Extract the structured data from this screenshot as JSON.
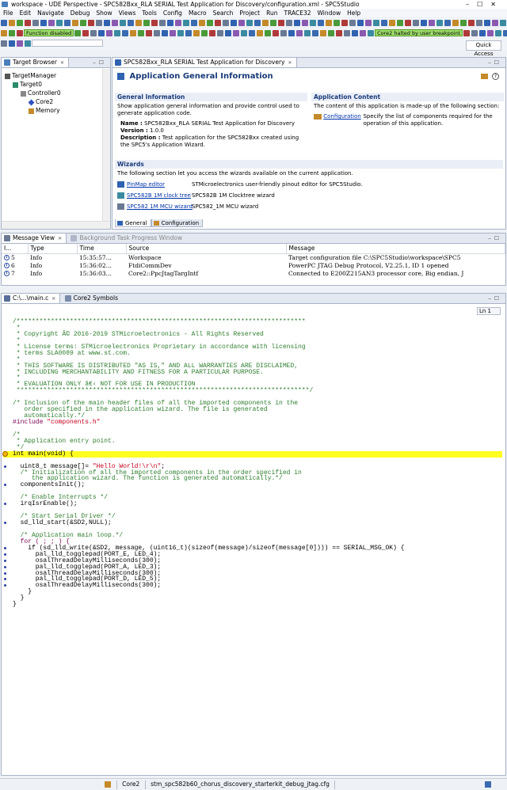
{
  "window": {
    "title": "workspace - UDE Perspective - SPC582Bxx_RLA SERIAL Test Application for Discovery/configuration.xml - SPC5Studio"
  },
  "menu": [
    "File",
    "Edit",
    "Navigate",
    "Debug",
    "Show",
    "Views",
    "Tools",
    "Config",
    "Macro",
    "Search",
    "Project",
    "Run",
    "TRACE32",
    "Window",
    "Help"
  ],
  "toolbar": {
    "function_status": "Function disabled",
    "halt_status": "Core2 halted by user breakpoint",
    "quick_access": "Quick Access"
  },
  "target_browser": {
    "tab_label": "Target Browser",
    "items": [
      {
        "label": "TargetManager",
        "level": 0
      },
      {
        "label": "Target0",
        "level": 1
      },
      {
        "label": "Controller0",
        "level": 2
      },
      {
        "label": "Core2",
        "level": 3
      },
      {
        "label": "Memory",
        "level": 3
      }
    ]
  },
  "app_editor": {
    "tab_label": "SPC582Bxx_RLA SERIAL Test Application for Discovery",
    "title": "Application General Information",
    "general": {
      "header": "General Information",
      "description": "Show application general information and provide control used to generate application code.",
      "name_label": "Name :",
      "name_value": "SPC582Bxx_RLA SERIAL Test Application for Discovery",
      "version_label": "Version :",
      "version_value": "1.0.0",
      "description_label": "Description :",
      "description_value": "Test application for the SPC582Bxx created using the SPC5's Application Wizard."
    },
    "content": {
      "header": "Application Content",
      "description": "The content of this application is made-up of the following section:",
      "link": "Configuration",
      "link_desc": "Specify the list of components required for the operation of this application."
    },
    "wizards": {
      "header": "Wizards",
      "description": "The following section let you access the wizards available on the current application.",
      "items": [
        {
          "link": "PinMap editor",
          "desc": "STMicroelectronics user-friendly pinout editor for SPC5Studio."
        },
        {
          "link": "SPC582B 1M clock tree",
          "desc": "SPC582B 1M Clocktree wizard"
        },
        {
          "link": "SPC582 1M MCU wizard",
          "desc": "SPC582_1M MCU wizard"
        }
      ]
    },
    "bottom_tabs": [
      "General",
      "Configuration"
    ]
  },
  "message_view": {
    "tabs": [
      "Message View",
      "Background Task Progress Window"
    ],
    "columns": [
      "I...",
      "Type",
      "Time",
      "Source",
      "Message"
    ],
    "rows": [
      {
        "id": "5",
        "type": "Info",
        "time": "15:35:57...",
        "source": "Workspace",
        "message": "Target configuration file C:\\SPC5Studio\\workspace\\SPC5"
      },
      {
        "id": "6",
        "type": "Info",
        "time": "15:36:02...",
        "source": "FtdiCommDev",
        "message": "PowerPC JTAG Debug Protocol, V2.25.1, ID 1 opened"
      },
      {
        "id": "7",
        "type": "Info",
        "time": "15:36:03...",
        "source": "Core2::PpcJtagTargIntf",
        "message": "Connected to E200Z215AN3 processor core, Big endian, J"
      }
    ]
  },
  "code_editor": {
    "tabs": [
      "C:\\...\\main.c",
      "Core2 Symbols"
    ],
    "position": "Ln 1",
    "lines": [
      {
        "t": "/****************************************************************************",
        "s": "c"
      },
      {
        "t": " *",
        "s": "c"
      },
      {
        "t": " * Copyright Â© 2016-2019 STMicroelectronics - All Rights Reserved",
        "s": "c"
      },
      {
        "t": " *",
        "s": "c"
      },
      {
        "t": " * License terms: STMicroelectronics Proprietary in accordance with licensing",
        "s": "c"
      },
      {
        "t": " * terms SLA0089 at www.st.com.",
        "s": "c"
      },
      {
        "t": " *",
        "s": "c"
      },
      {
        "t": " * THIS SOFTWARE IS DISTRIBUTED \"AS IS,\" AND ALL WARRANTIES ARE DISCLAIMED,",
        "s": "c"
      },
      {
        "t": " * INCLUDING MERCHANTABILITY AND FITNESS FOR A PARTICULAR PURPOSE.",
        "s": "c"
      },
      {
        "t": " *",
        "s": "c"
      },
      {
        "t": " * EVALUATION ONLY â€‹ NOT FOR USE IN PRODUCTION",
        "s": "c"
      },
      {
        "t": " *****************************************************************************/",
        "s": "c"
      },
      {
        "t": "",
        "s": ""
      },
      {
        "t": "/* Inclusion of the main header files of all the imported components in the",
        "s": "c"
      },
      {
        "t": "   order specified in the application wizard. The file is generated",
        "s": "c"
      },
      {
        "t": "   automatically.*/",
        "s": "c"
      },
      {
        "t": "#include \"components.h\"",
        "s": "inc"
      },
      {
        "t": "",
        "s": ""
      },
      {
        "t": "/*",
        "s": "c"
      },
      {
        "t": " * Application entry point.",
        "s": "c"
      },
      {
        "t": " */",
        "s": "c"
      },
      {
        "t": "int main(void) {",
        "s": "hl"
      },
      {
        "t": "",
        "s": ""
      },
      {
        "t": "  uint8_t message[]= \"Hello World!\\r\\n\";",
        "s": "str",
        "bp": true
      },
      {
        "t": "  /* Initialization of all the imported components in the order specified in",
        "s": "c"
      },
      {
        "t": "     the application wizard. The function is generated automatically.*/",
        "s": "c"
      },
      {
        "t": "  componentsInit();",
        "s": "",
        "bp": true
      },
      {
        "t": "",
        "s": ""
      },
      {
        "t": "  /* Enable Interrupts */",
        "s": "c"
      },
      {
        "t": "  irqIsrEnable();",
        "s": "",
        "bp": true
      },
      {
        "t": "",
        "s": ""
      },
      {
        "t": "  /* Start Serial Driver */",
        "s": "c"
      },
      {
        "t": "  sd_lld_start(&SD2,NULL);",
        "s": "",
        "bp": true
      },
      {
        "t": "",
        "s": ""
      },
      {
        "t": "  /* Application main loop.*/",
        "s": "c"
      },
      {
        "t": "  for ( ; ; ) {",
        "s": "kw"
      },
      {
        "t": "    if (sd_lld_write(&SD2, message, (uint16_t)(sizeof(message)/sizeof(message[0]))) == SERIAL_MSG_OK) {",
        "s": "",
        "bp": true
      },
      {
        "t": "      pal_lld_togglepad(PORT_E, LED_4);",
        "s": "",
        "bp": true
      },
      {
        "t": "      osalThreadDelayMilliseconds(300);",
        "s": "",
        "bp": true
      },
      {
        "t": "      pal_lld_togglepad(PORT_A, LED_3);",
        "s": "",
        "bp": true
      },
      {
        "t": "      osalThreadDelayMilliseconds(300);",
        "s": "",
        "bp": true
      },
      {
        "t": "      pal_lld_togglepad(PORT_D, LED_5);",
        "s": "",
        "bp": true
      },
      {
        "t": "      osalThreadDelayMilliseconds(300);",
        "s": "",
        "bp": true
      },
      {
        "t": "    }",
        "s": ""
      },
      {
        "t": "  }",
        "s": ""
      },
      {
        "t": "}",
        "s": ""
      }
    ]
  },
  "status_bar": {
    "core": "Core2",
    "config": "stm_spc582b60_chorus_discovery_starterkit_debug_jtag.cfg"
  }
}
